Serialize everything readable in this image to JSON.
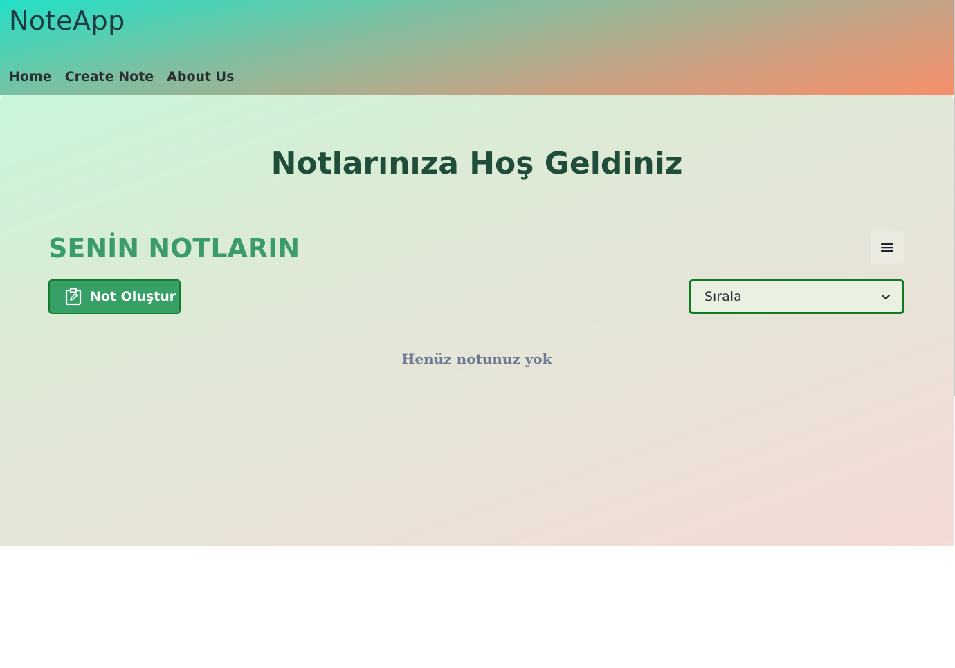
{
  "header": {
    "brand": "NoteApp",
    "nav": [
      {
        "label": "Home"
      },
      {
        "label": "Create Note"
      },
      {
        "label": "About Us"
      }
    ]
  },
  "main": {
    "welcome_title": "Notlarınıza Hoş Geldiniz",
    "section_title": "SENİN NOTLARIN",
    "menu_icon": "hamburger-menu-icon",
    "create_button": {
      "label": "Not Oluştur",
      "icon": "clipboard-edit-icon"
    },
    "sort_select": {
      "selected": "Sırala",
      "icon": "chevron-down-icon"
    },
    "empty_message": "Henüz notunuz yok"
  },
  "colors": {
    "brand_accent": "#36a066",
    "section_title": "#3a9c68",
    "select_border": "#0f7a1f",
    "empty_text": "#6f7b93"
  }
}
